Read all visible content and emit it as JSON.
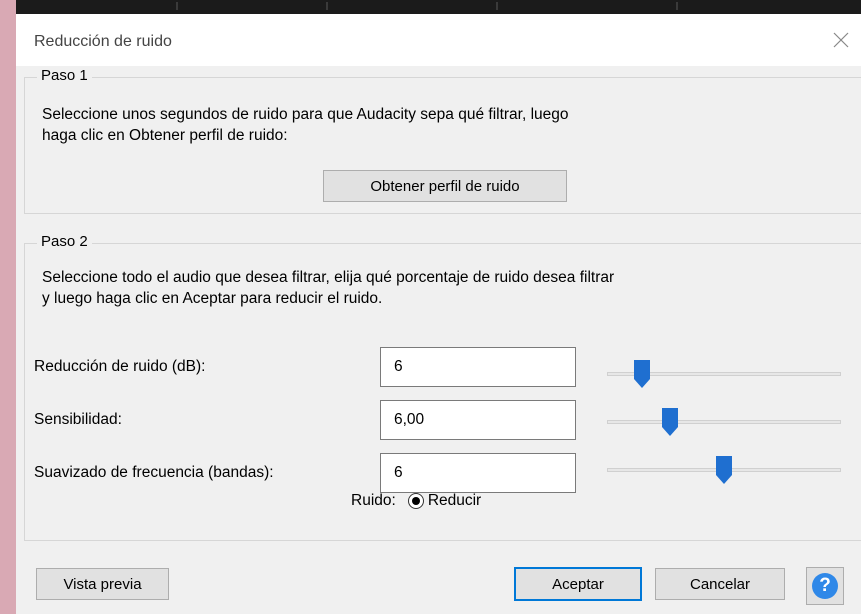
{
  "dialog": {
    "title": "Reducción de ruido",
    "close_icon": "close-icon"
  },
  "step1": {
    "legend": "Paso 1",
    "line1": "Seleccione unos segundos de ruido para que Audacity sepa qué filtrar, luego",
    "line2": "haga clic en Obtener perfil de ruido:",
    "profile_button": "Obtener perfil de ruido"
  },
  "step2": {
    "legend": "Paso 2",
    "line1": "Seleccione todo el audio que desea filtrar, elija qué porcentaje de ruido desea filtrar",
    "line2": "y luego haga clic en Aceptar para reducir el ruido.",
    "rows": [
      {
        "label": "Reducción de ruido (dB):",
        "value": "6",
        "slider_level": 0.15
      },
      {
        "label": "Sensibilidad:",
        "value": "6,00",
        "slider_level": 0.27
      },
      {
        "label": "Suavizado de frecuencia (bandas):",
        "value": "6",
        "slider_level": 0.5
      }
    ],
    "noise_label": "Ruido:",
    "noise_option": "Reducir"
  },
  "footer": {
    "preview_button": "Vista previa",
    "ok_button": "Aceptar",
    "cancel_button": "Cancelar",
    "help_label": "?",
    "help_icon": "help-icon"
  },
  "colors": {
    "accent": "#0078d7",
    "slider_thumb": "#1f6fd0",
    "help": "#2f88e8"
  }
}
